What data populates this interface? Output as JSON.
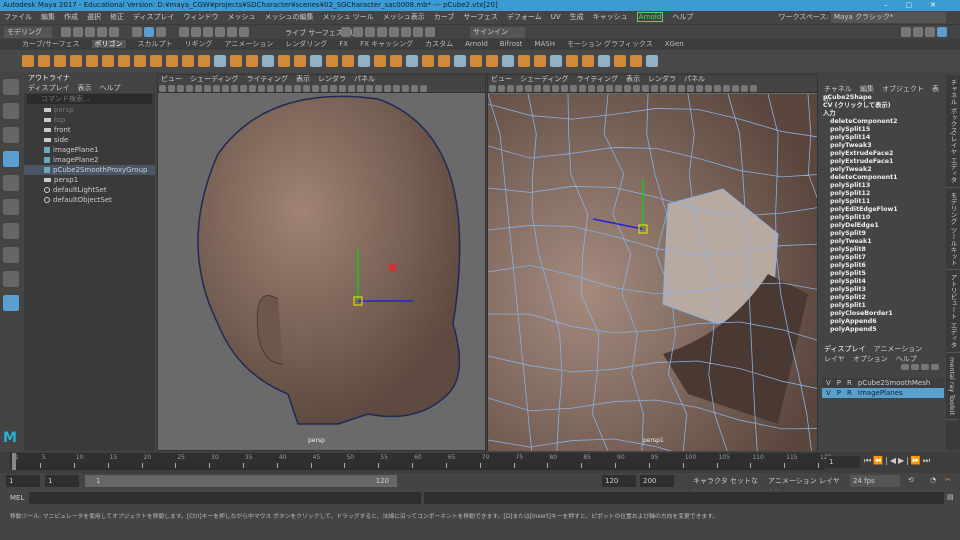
{
  "title": "Autodesk Maya 2017 - Educational Version: D:¥maya_CGW¥projects¥SDCharacter¥scenes¥02_SGCharacter_sac0008.mb*  ---  pCube2.vtx[20]",
  "menu": [
    "ファイル",
    "編集",
    "作成",
    "選択",
    "修正",
    "ディスプレイ",
    "ウィンドウ",
    "メッシュ",
    "メッシュの編集",
    "メッシュ ツール",
    "メッシュ表示",
    "カーブ",
    "サーフェス",
    "デフォーム",
    "UV",
    "生成",
    "キャッシュ",
    "Arnold",
    "ヘルプ"
  ],
  "workspace": {
    "label": "ワークスペース:",
    "value": "Maya クラシック*"
  },
  "status": {
    "mode": "モデリング",
    "live": "ライブ サーフェスなし",
    "signin": "サインイン"
  },
  "shelf_tabs": [
    "カーブ/サーフェス",
    "ポリゴン",
    "スカルプト",
    "リギング",
    "アニメーション",
    "レンダリング",
    "FX",
    "FX キャッシング",
    "カスタム",
    "Arnold",
    "Bifrost",
    "MASH",
    "モーション グラフィックス",
    "XGen"
  ],
  "outliner": {
    "title": "アウトライナ",
    "menu": [
      "ディスプレイ",
      "表示",
      "ヘルプ"
    ],
    "search_placeholder": "コマンド検索...",
    "items": [
      {
        "label": "persp",
        "type": "camera",
        "dim": true
      },
      {
        "label": "top",
        "type": "camera",
        "dim": true
      },
      {
        "label": "front",
        "type": "camera"
      },
      {
        "label": "side",
        "type": "camera"
      },
      {
        "label": "imagePlane1",
        "type": "imageplane"
      },
      {
        "label": "imagePlane2",
        "type": "imageplane"
      },
      {
        "label": "pCube2SmoothProxyGroup",
        "type": "group",
        "selected": true
      },
      {
        "label": "persp1",
        "type": "camera"
      },
      {
        "label": "defaultLightSet",
        "type": "set"
      },
      {
        "label": "defaultObjectSet",
        "type": "set"
      }
    ]
  },
  "viewport_menu": [
    "ビュー",
    "シェーディング",
    "ライティング",
    "表示",
    "レンダラ",
    "パネル"
  ],
  "viewports": [
    {
      "label": "persp"
    },
    {
      "label": "persp1"
    }
  ],
  "channel_box": {
    "menu": [
      "チャネル",
      "編集",
      "オブジェクト",
      "表示"
    ],
    "shape": "pCube2Shape",
    "cv": "CV (クリックして表示)",
    "inputs_label": "入力",
    "inputs": [
      "deleteComponent2",
      "polySplit15",
      "polySplit14",
      "polyTweak3",
      "polyExtrudeFace2",
      "polyExtrudeFace1",
      "polyTweak2",
      "deleteComponent1",
      "polySplit13",
      "polySplit12",
      "polySplit11",
      "polyEditEdgeFlow1",
      "polySplit10",
      "polyDelEdge1",
      "polySplit9",
      "polyTweak1",
      "polySplit8",
      "polySplit7",
      "polySplit6",
      "polySplit5",
      "polySplit4",
      "polySplit3",
      "polySplit2",
      "polySplit1",
      "polyCloseBorder1",
      "polyAppend6",
      "polyAppend5"
    ]
  },
  "layer_editor": {
    "tabs": [
      "ディスプレイ",
      "アニメーション"
    ],
    "menu": [
      "レイヤ",
      "オプション",
      "ヘルプ"
    ],
    "layers": [
      {
        "v": "V",
        "p": "P",
        "r": "R",
        "name": "pCube2SmoothMesh",
        "selected": false
      },
      {
        "v": "V",
        "p": "P",
        "r": "R",
        "name": "ImagePlanes",
        "selected": true
      }
    ]
  },
  "side_tabs": [
    "チャネル ボックス/レイヤ エディタ",
    "モデリング ツールキット",
    "アトリビュート エディタ",
    "mental ray Toolkit"
  ],
  "timeline": {
    "ticks": [
      1,
      5,
      10,
      15,
      20,
      25,
      30,
      35,
      40,
      45,
      50,
      55,
      60,
      65,
      70,
      75,
      80,
      85,
      90,
      95,
      100,
      105,
      110,
      115,
      120
    ],
    "current_frame": "1"
  },
  "range": {
    "start": "1",
    "anim_start": "1",
    "range_start": "1",
    "range_end": "120",
    "end": "120",
    "anim_end": "200",
    "character_set": "キャラクタ セットなし",
    "anim_layer": "アニメーション レイヤなし",
    "fps": "24 fps"
  },
  "mel": {
    "label": "MEL"
  },
  "help_line": "移動ツール: マニピュレータを使用してオブジェクトを移動します。[Ctrl]キーを押しながら中マウス ボタンをクリックして、ドラッグすると、法線に沿ってコンポーネントを移動できます。[D]または[Insert]キーを押すと、ピボットの位置および軸の方向を変更できます。",
  "colors": {
    "title_bar": "#3c9bd0",
    "selection": "#5aa0cc",
    "shelf_orange": "#d08a3a"
  }
}
